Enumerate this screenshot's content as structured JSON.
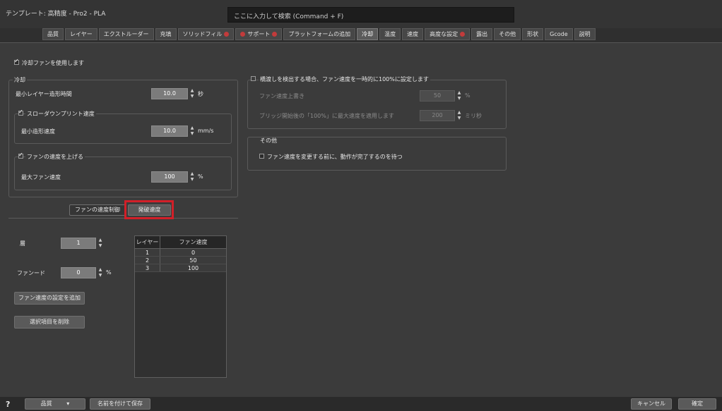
{
  "titlebar": {
    "title": "テンプレート: 高精度 - Pro2 - PLA",
    "search_text": "ここに入力して検索 (Command + F)"
  },
  "tabs": [
    {
      "label": "品質",
      "red": false
    },
    {
      "label": "レイヤー",
      "red": false
    },
    {
      "label": "エクストルーダー",
      "red": false
    },
    {
      "label": "充填",
      "red": false
    },
    {
      "label": "ソリッドフィル",
      "red": true
    },
    {
      "label": "サポート",
      "red": true
    },
    {
      "label": "プラットフォームの追加",
      "red": false
    },
    {
      "label": "冷却",
      "red": false,
      "active": true
    },
    {
      "label": "温度",
      "red": false
    },
    {
      "label": "速度",
      "red": false
    },
    {
      "label": "高度な設定",
      "red": true
    },
    {
      "label": "露出",
      "red": false
    },
    {
      "label": "その他",
      "red": false
    },
    {
      "label": "形状",
      "red": false
    },
    {
      "label": "Gcode",
      "red": false
    },
    {
      "label": "説明",
      "red": false
    }
  ],
  "cooling": {
    "enable_fan_label": "冷却ファンを使用します",
    "enable_fan_checked": true,
    "section_label": "冷却",
    "min_layer_time_label": "最小レイヤー造形時間",
    "min_layer_time_value": "10.0",
    "min_layer_time_unit": "秒",
    "slowdown_label": "スローダウンプリント速度",
    "slowdown_checked": true,
    "min_speed_label": "最小造形速度",
    "min_speed_value": "10.0",
    "min_speed_unit": "mm/s",
    "increase_fan_label": "ファンの速度を上げる",
    "increase_fan_checked": true,
    "max_fan_label": "最大ファン速度",
    "max_fan_value": "100",
    "max_fan_unit": "%"
  },
  "bridging": {
    "label": "橋渡しを検出する場合、ファン速度を一時的に100%に設定します",
    "checked": false,
    "override_label": "ファン速度上書き",
    "override_value": "50",
    "override_unit": "%",
    "adjust_label": "ブリッジ開始後の「100%」に最大速度を適用します",
    "adjust_value": "200",
    "adjust_unit": "ミリ秒"
  },
  "other": {
    "section_label": "その他",
    "label": "ファン速度を変更する前に、動作が完了するのを待つ",
    "checked": false
  },
  "subtabs": {
    "fan_control": "ファンの速度制御",
    "blip": "発破速度"
  },
  "fan_controls": {
    "layer_label": "層",
    "layer_value": "1",
    "fan_label": "ファンード",
    "fan_value": "0",
    "fan_unit": "%",
    "add_button": "ファン速度の設定を追加",
    "delete_button": "選択項目を削除"
  },
  "fan_table": {
    "headers": [
      "レイヤー",
      "ファン速度"
    ],
    "rows": [
      [
        "1",
        "0"
      ],
      [
        "2",
        "50"
      ],
      [
        "3",
        "100"
      ]
    ]
  },
  "footer": {
    "help": "?",
    "dropdown": "品質",
    "save_as": "名前を付けて保存",
    "cancel": "キャンセル",
    "ok": "確定"
  }
}
